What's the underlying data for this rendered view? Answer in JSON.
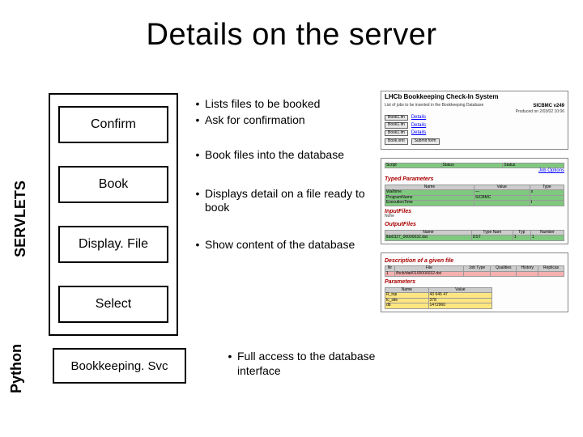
{
  "title": "Details on the server",
  "sidebar": {
    "servlets_label": "SERVLETS",
    "python_label": "Python"
  },
  "servlets": [
    {
      "name": "Confirm",
      "bullets": [
        "Lists files to be booked",
        "Ask for confirmation"
      ]
    },
    {
      "name": "Book",
      "bullets": [
        "Book files into the database"
      ]
    },
    {
      "name": "Display. File",
      "bullets": [
        "Displays detail on a file ready to book"
      ]
    },
    {
      "name": "Select",
      "bullets": [
        "Show content of the database"
      ]
    }
  ],
  "python": {
    "name": "Bookkeeping. Svc",
    "bullets": [
      "Full access to the database interface"
    ]
  },
  "right": {
    "panel1": {
      "title": "LHCb Bookkeeping Check-In System",
      "subtitle_left": "List of jobs to be inserted in the Bookkeeping Database",
      "subtitle_right": "SICBMC v249",
      "produced": "Produced on 2/03/02 10:06",
      "buttons": [
        [
          "Book1.lm",
          "Details"
        ],
        [
          "Book1.lm",
          "Details"
        ],
        [
          "Book1.lm",
          "Details"
        ]
      ],
      "action_buttons": [
        "Book.xml",
        "Submit form"
      ]
    },
    "panel2": {
      "headers": [
        "Script",
        "Status",
        "Status"
      ],
      "sec": "Typed Parameters",
      "thead": [
        "Name",
        "Value",
        "Type"
      ],
      "rows": [
        [
          "Walltime",
          "—",
          "s"
        ],
        [
          "ProgramName",
          "SICBMC",
          ""
        ],
        [
          "ExecutionTime",
          "",
          "t"
        ]
      ],
      "link1": "Job Options",
      "sec2": "InputFiles",
      "empty": "None",
      "sec3": "OutputFiles",
      "out_thead": [
        "Name",
        "Type Nam",
        "Typ",
        "Number"
      ],
      "out_row": [
        "lbb0327_00000032.dst",
        "DST",
        "1",
        "1"
      ]
    },
    "panel3": {
      "sec": "Description of a given file",
      "thead": [
        "Nr",
        "File",
        "Job Type",
        "Qualities",
        "History",
        "Replicas"
      ],
      "row": [
        "1",
        "/lhcb/dat/0100000032.dst",
        "",
        "",
        "",
        ""
      ],
      "sec2": "Parameters",
      "p_thead": [
        "Name",
        "Value"
      ],
      "p_rows": [
        [
          "R_top",
          "43 645 47"
        ],
        [
          "lc_site",
          "378"
        ],
        [
          "db",
          "1472960"
        ]
      ]
    }
  }
}
